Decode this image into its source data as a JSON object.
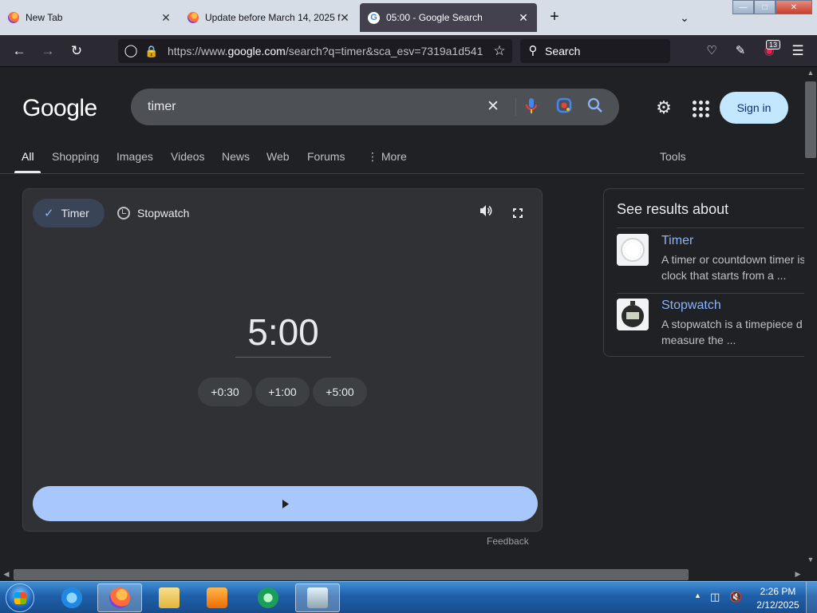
{
  "browser": {
    "tabs": [
      {
        "title": "New Tab",
        "favicon": "firefox-icon",
        "active": false
      },
      {
        "title": "Update before March 14, 2025 f",
        "favicon": "firefox-icon",
        "active": false
      },
      {
        "title": "05:00 - Google Search",
        "favicon": "google-icon",
        "active": true
      }
    ],
    "url_prefix": "https://www.",
    "url_domain": "google.com",
    "url_rest": "/search?q=timer&sca_esv=7319a1d541",
    "search_placeholder": "Search",
    "extension_badge": "13"
  },
  "google": {
    "logo": "Google",
    "query": "timer",
    "signin_label": "Sign in",
    "nav_tabs": [
      "All",
      "Shopping",
      "Images",
      "Videos",
      "News",
      "Web",
      "Forums"
    ],
    "more_label": "More",
    "tools_label": "Tools",
    "active_tab": "All"
  },
  "timer_card": {
    "timer_tab": "Timer",
    "stopwatch_tab": "Stopwatch",
    "time": "5:00",
    "add_buttons": [
      "+0:30",
      "+1:00",
      "+5:00"
    ],
    "start_icon": "play-icon"
  },
  "feedback_label": "Feedback",
  "side_panel": {
    "title": "See results about",
    "items": [
      {
        "name": "Timer",
        "desc_line1": "A timer or countdown timer is",
        "desc_line2": "clock that starts from a ..."
      },
      {
        "name": "Stopwatch",
        "desc_line1": "A stopwatch is a timepiece d",
        "desc_line2": "measure the ..."
      }
    ]
  },
  "taskbar": {
    "time": "2:26 PM",
    "date": "2/12/2025"
  },
  "colors": {
    "page_bg": "#202124",
    "card_bg": "#303134",
    "accent": "#8ab4f8",
    "start_bar": "#a8c7fa",
    "signin_bg": "#c2e7ff"
  }
}
